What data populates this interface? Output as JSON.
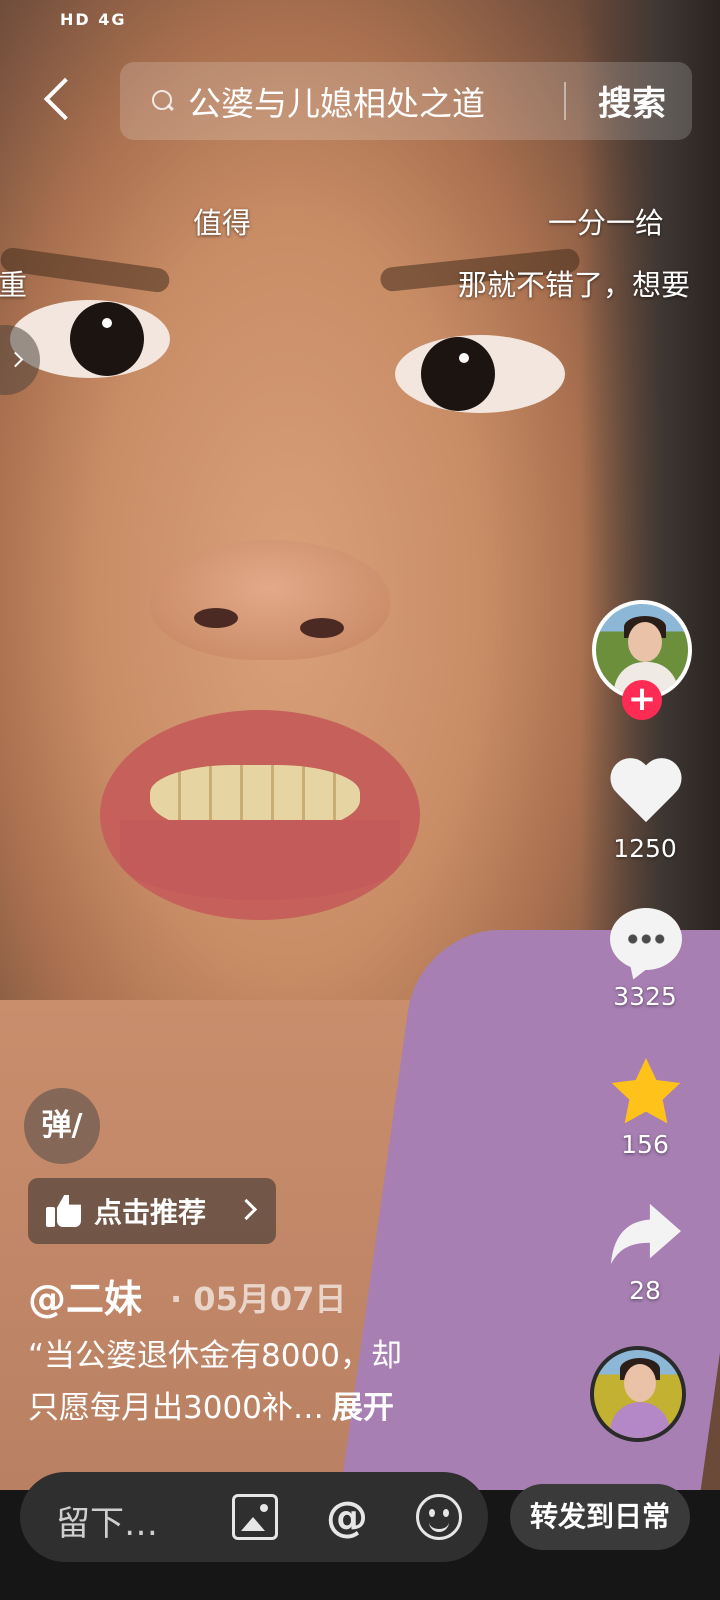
{
  "status_bar": {
    "text": "HD 4G"
  },
  "search": {
    "query": "公婆与儿媳相处之道",
    "button_label": "搜索"
  },
  "danmaku": [
    "值得",
    "一分一给",
    "重",
    "那就不错了，想要"
  ],
  "rail": {
    "like_count": "1250",
    "comment_count": "3325",
    "favorite_count": "156",
    "share_count": "28",
    "follow_symbol": "+"
  },
  "danmu_toggle": "弹/",
  "recommend": {
    "label": "点击推荐"
  },
  "post": {
    "author": "@二妹",
    "date": "· 05月07日",
    "desc_line1": "“当公婆退休金有8000，却",
    "desc_line2": "只愿每月出3000补…",
    "expand": "展开"
  },
  "bottom_bar": {
    "placeholder": "留下…",
    "at_symbol": "@",
    "forward_label": "转发到日常"
  },
  "colors": {
    "follow": "#fe2c55",
    "star": "#ffc21a",
    "shirt": "#a77fb3"
  },
  "icons": [
    "back-arrow-icon",
    "search-icon",
    "heart-icon",
    "comment-icon",
    "star-icon",
    "share-icon",
    "thumbs-up-icon",
    "image-icon",
    "at-icon",
    "emoji-icon"
  ]
}
